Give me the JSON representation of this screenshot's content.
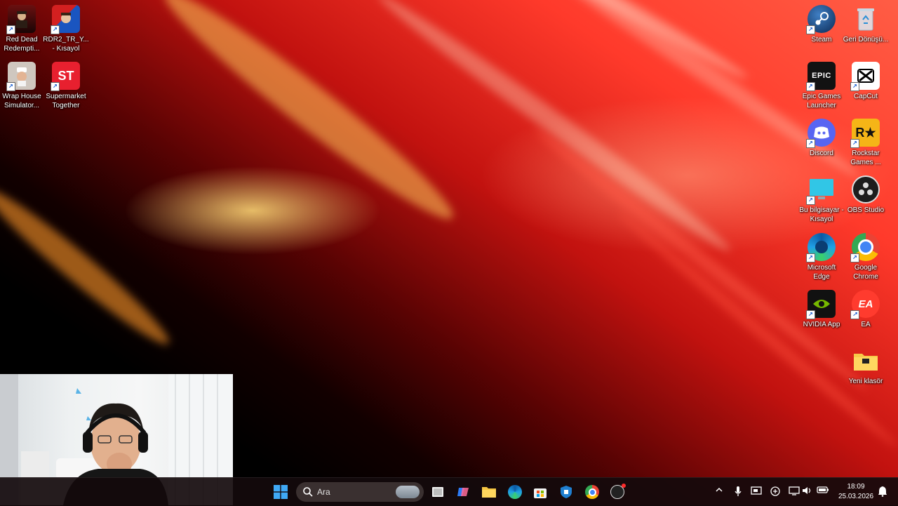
{
  "desktop": {
    "left_icons": [
      {
        "label": "Red Dead Redempti...",
        "icon": "red-dead-redemption-icon"
      },
      {
        "label": "RDR2_TR_Y... - Kısayol",
        "icon": "rdr2-tr-shortcut-icon"
      },
      {
        "label": "Wrap House Simulator...",
        "icon": "wrap-house-simulator-icon"
      },
      {
        "label": "Supermarket Together",
        "icon": "supermarket-together-icon",
        "glyph": "ST"
      }
    ],
    "right_icons": [
      {
        "label": "Steam",
        "icon": "steam-icon"
      },
      {
        "label": "Geri Dönüşü...",
        "icon": "recycle-bin-icon"
      },
      {
        "label": "Epic Games Launcher",
        "icon": "epic-games-icon",
        "glyph": "EPIC"
      },
      {
        "label": "CapCut",
        "icon": "capcut-icon"
      },
      {
        "label": "Discord",
        "icon": "discord-icon"
      },
      {
        "label": "Rockstar Games ...",
        "icon": "rockstar-games-icon",
        "glyph": "R★"
      },
      {
        "label": "Bu bilgisayar - Kısayol",
        "icon": "this-pc-icon"
      },
      {
        "label": "OBS Studio",
        "icon": "obs-studio-icon"
      },
      {
        "label": "Microsoft Edge",
        "icon": "edge-icon"
      },
      {
        "label": "Google Chrome",
        "icon": "chrome-icon"
      },
      {
        "label": "NVIDIA App",
        "icon": "nvidia-icon"
      },
      {
        "label": "EA",
        "icon": "ea-icon",
        "glyph": "EA"
      },
      {
        "label": "Yeni klasör",
        "icon": "folder-icon"
      }
    ]
  },
  "taskbar": {
    "search_placeholder": "Ara",
    "apps": [
      "windows-start-icon",
      "search-icon",
      "task-view-icon",
      "copilot-icon",
      "file-explorer-icon",
      "edge-icon",
      "microsoft-store-icon",
      "shield-app-icon",
      "chrome-icon",
      "obs-studio-icon"
    ],
    "tray": [
      "chevron-up-icon",
      "microphone-icon",
      "window-icon",
      "network-icon",
      "display-icon",
      "volume-icon",
      "battery-icon"
    ],
    "time": "18:09",
    "date": "25.03.2026"
  },
  "colors": {
    "taskbar_bg": "#140a0c",
    "accent": "#ff3a2b"
  }
}
